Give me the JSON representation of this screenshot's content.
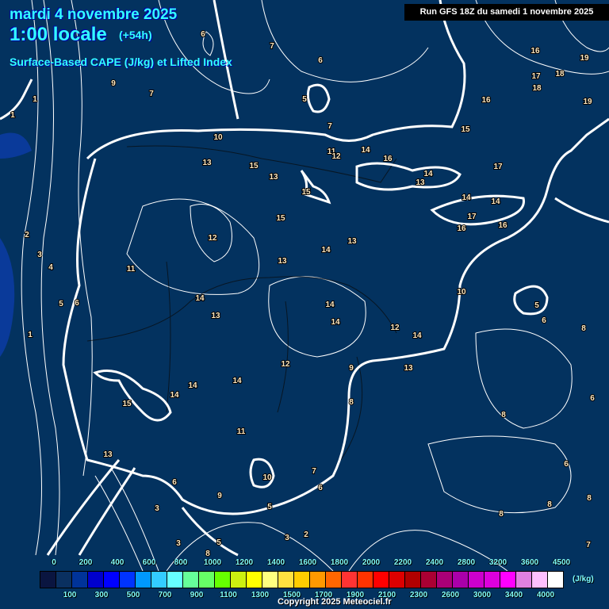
{
  "header": {
    "date": "mardi 4 novembre 2025",
    "time": "1:00 locale",
    "lead": "(+54h)",
    "parameter": "Surface-Based CAPE (J/kg) et Lifted Index",
    "run": "Run GFS 18Z du samedi 1 novembre 2025"
  },
  "legend": {
    "unit": "(J/kg)",
    "labels": [
      "0",
      "100",
      "200",
      "300",
      "400",
      "500",
      "600",
      "700",
      "800",
      "900",
      "1000",
      "1100",
      "1200",
      "1300",
      "1400",
      "1500",
      "1600",
      "1700",
      "1800",
      "1900",
      "2000",
      "2100",
      "2200",
      "2300",
      "2400",
      "2600",
      "2800",
      "3000",
      "3200",
      "3400",
      "3600",
      "4000",
      "4500"
    ],
    "colors": [
      "#0a1540",
      "#0a3060",
      "#003399",
      "#0000cc",
      "#0000ff",
      "#0033ff",
      "#0099ff",
      "#33ccff",
      "#66ffff",
      "#66ff99",
      "#66ff66",
      "#66ff00",
      "#ccf010",
      "#ffff00",
      "#ffff80",
      "#ffe040",
      "#ffcc00",
      "#ff9900",
      "#ff6600",
      "#ff3333",
      "#ff3300",
      "#ff0000",
      "#dd0000",
      "#b00000",
      "#aa0033",
      "#aa0077",
      "#aa00aa",
      "#cc00cc",
      "#dd00dd",
      "#ff00ff",
      "#e080e0",
      "#ffc0ff",
      "#ffffff"
    ]
  },
  "li_labels": [
    "6",
    "7",
    "6",
    "9",
    "7",
    "5",
    "1",
    "1",
    "7",
    "10",
    "11",
    "12",
    "14",
    "16",
    "15",
    "16",
    "16",
    "19",
    "17",
    "18",
    "18",
    "19",
    "17",
    "13",
    "15",
    "13",
    "15",
    "14",
    "13",
    "14",
    "14",
    "17",
    "16",
    "16",
    "15",
    "12",
    "13",
    "14",
    "13",
    "11",
    "2",
    "3",
    "4",
    "5",
    "6",
    "1",
    "14",
    "13",
    "14",
    "14",
    "12",
    "14",
    "10",
    "5",
    "6",
    "8",
    "12",
    "9",
    "13",
    "14",
    "14",
    "14",
    "15",
    "8",
    "6",
    "8",
    "11",
    "13",
    "7",
    "6",
    "6",
    "10",
    "6",
    "9",
    "5",
    "3",
    "8",
    "8",
    "8",
    "2",
    "3",
    "3",
    "7",
    "5",
    "8"
  ],
  "copyright": "Copyright 2025 Meteociel.fr",
  "colors": {
    "background": "#03325f",
    "contour": "#ffffff",
    "ocean_low": "#0a3a9a",
    "title": "#33ffff"
  }
}
